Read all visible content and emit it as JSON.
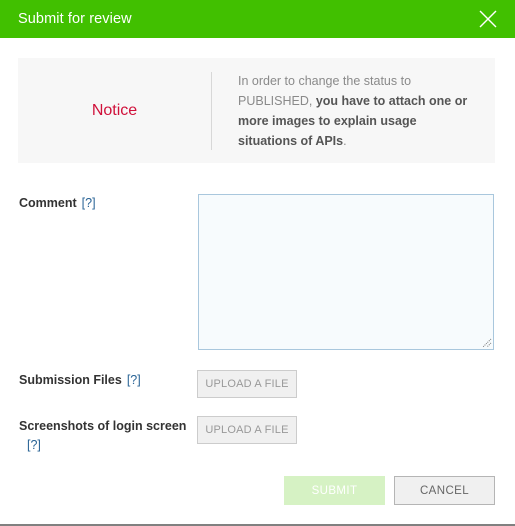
{
  "header": {
    "title": "Submit for review",
    "close_icon": "close-icon",
    "background_color": "#41c000"
  },
  "notice": {
    "label": "Notice",
    "label_color": "#d0103a",
    "text_plain_1": "In order to change the status to PUBLISHED, ",
    "text_bold": "you have to attach one or more images to explain usage situations of APIs",
    "text_plain_2": "."
  },
  "form": {
    "comment": {
      "label": "Comment",
      "help": "[?]",
      "value": "",
      "placeholder": ""
    },
    "submission_files": {
      "label": "Submission Files",
      "help": "[?]",
      "upload_label": "UPLOAD A FILE"
    },
    "screenshots": {
      "label": "Screenshots of login screen",
      "help": "[?]",
      "upload_label": "UPLOAD A FILE"
    }
  },
  "footer": {
    "submit_label": "SUBMIT",
    "submit_color": "#d6f2c4",
    "cancel_label": "CANCEL"
  }
}
